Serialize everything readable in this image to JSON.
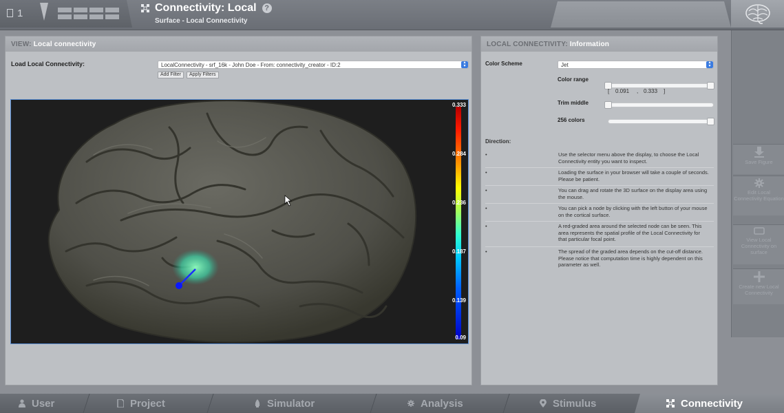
{
  "topbar": {
    "project_count": "1",
    "title": "Connectivity: Local",
    "subtitle": "Surface - Local Connectivity",
    "help": "?"
  },
  "view_panel": {
    "header_prefix": "VIEW:",
    "header_title": "Local connectivity",
    "load_label": "Load Local Connectivity:",
    "selector_value": "LocalConnectivity - srf_16k - John Doe - From: connectivity_creator - ID:2",
    "add_filter": "Add Filter",
    "apply_filters": "Apply Filters",
    "colorbar_labels": [
      "0.333",
      "0.284",
      "0.236",
      "0.187",
      "0.139",
      "0.09"
    ]
  },
  "info_panel": {
    "header_prefix": "LOCAL CONNECTIVITY:",
    "header_title": "Information",
    "color_scheme_label": "Color Scheme",
    "color_scheme_value": "Jet",
    "color_range_label": "Color range",
    "range_min": "0.091",
    "range_max": "0.333",
    "range_open": "[",
    "range_sep": ",",
    "range_close": "]",
    "trim_middle_label": "Trim middle",
    "colors_label": "256 colors",
    "direction_label": "Direction:",
    "directions": [
      "Use the selector menu above the display, to choose the Local Connectivity entity you want to inspect.",
      "Loading the surface in your browser will take a couple of seconds. Please be patient.",
      "You can drag and rotate the 3D surface on the display area using the mouse.",
      "You can pick a node by clicking with the left button of your mouse on the cortical surface.",
      "A red-graded area around the selected node can be seen. This area represents the spatial profile of the Local Connectivity for that particular focal point.",
      "The spread of the graded area depends on the cut-off distance. Please notice that computation time is highly dependent on this parameter as well."
    ],
    "bullet": "•"
  },
  "sidebar": {
    "save_figure": "Save Figure",
    "edit_equation": "Edit Local Connectivity Equation",
    "view_on_surface": "View Local Connectivity on surface",
    "create_new": "Create new Local Connectivity"
  },
  "bottom_nav": {
    "tabs": [
      "User",
      "Project",
      "Simulator",
      "Analysis",
      "Stimulus",
      "Connectivity"
    ],
    "active": "Connectivity"
  },
  "colors": {
    "accent": "#3a7be0",
    "active_tab": "#8d9197",
    "highlight": "#4fe0b0",
    "node": "#0a18ff"
  }
}
